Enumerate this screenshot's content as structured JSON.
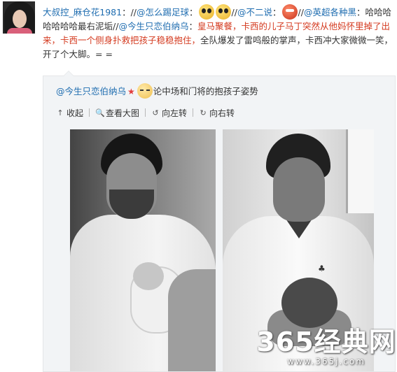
{
  "post": {
    "author": "大叔控_麻仓花1981",
    "colon": "：",
    "seg1": "//",
    "user1": "@怎么踢足球",
    "seg2": "：",
    "seg3": "//",
    "user2": "@不二说",
    "seg4": "：",
    "seg5": "//",
    "user3": "@英超各种黑",
    "seg6": "：哈哈哈哈哈哈哈最右泥垢//",
    "user4": "@今生只恋伯纳乌",
    "seg7": "：",
    "red_text": "皇马聚餐，卡西的儿子马丁突然从他妈怀里掉了出来，卡西一个侧身扑救把孩子稳稳抱住，",
    "seg8": "全队爆发了雷鸣般的掌声，卡西冲大家微微一笑，开了个大脚。= ="
  },
  "repost": {
    "author": "@今生只恋伯纳乌",
    "star": "★",
    "text": "论中场和门将的抱孩子姿势",
    "actions": [
      {
        "icon": "↑",
        "label": "收起"
      },
      {
        "icon": "🔍",
        "label": "查看大图"
      },
      {
        "icon": "↺",
        "label": "向左转"
      },
      {
        "icon": "↻",
        "label": "向右转"
      }
    ]
  },
  "photo_left": {
    "icon": "photo-left"
  },
  "photo_right": {
    "icon": "photo-right",
    "logo": "♣"
  },
  "watermark": {
    "main": "365经典网",
    "url": "www.365j.com"
  },
  "colors": {
    "link": "#1f6db0",
    "highlight": "#d43a1f",
    "repost_bg": "#f2f4f6"
  }
}
